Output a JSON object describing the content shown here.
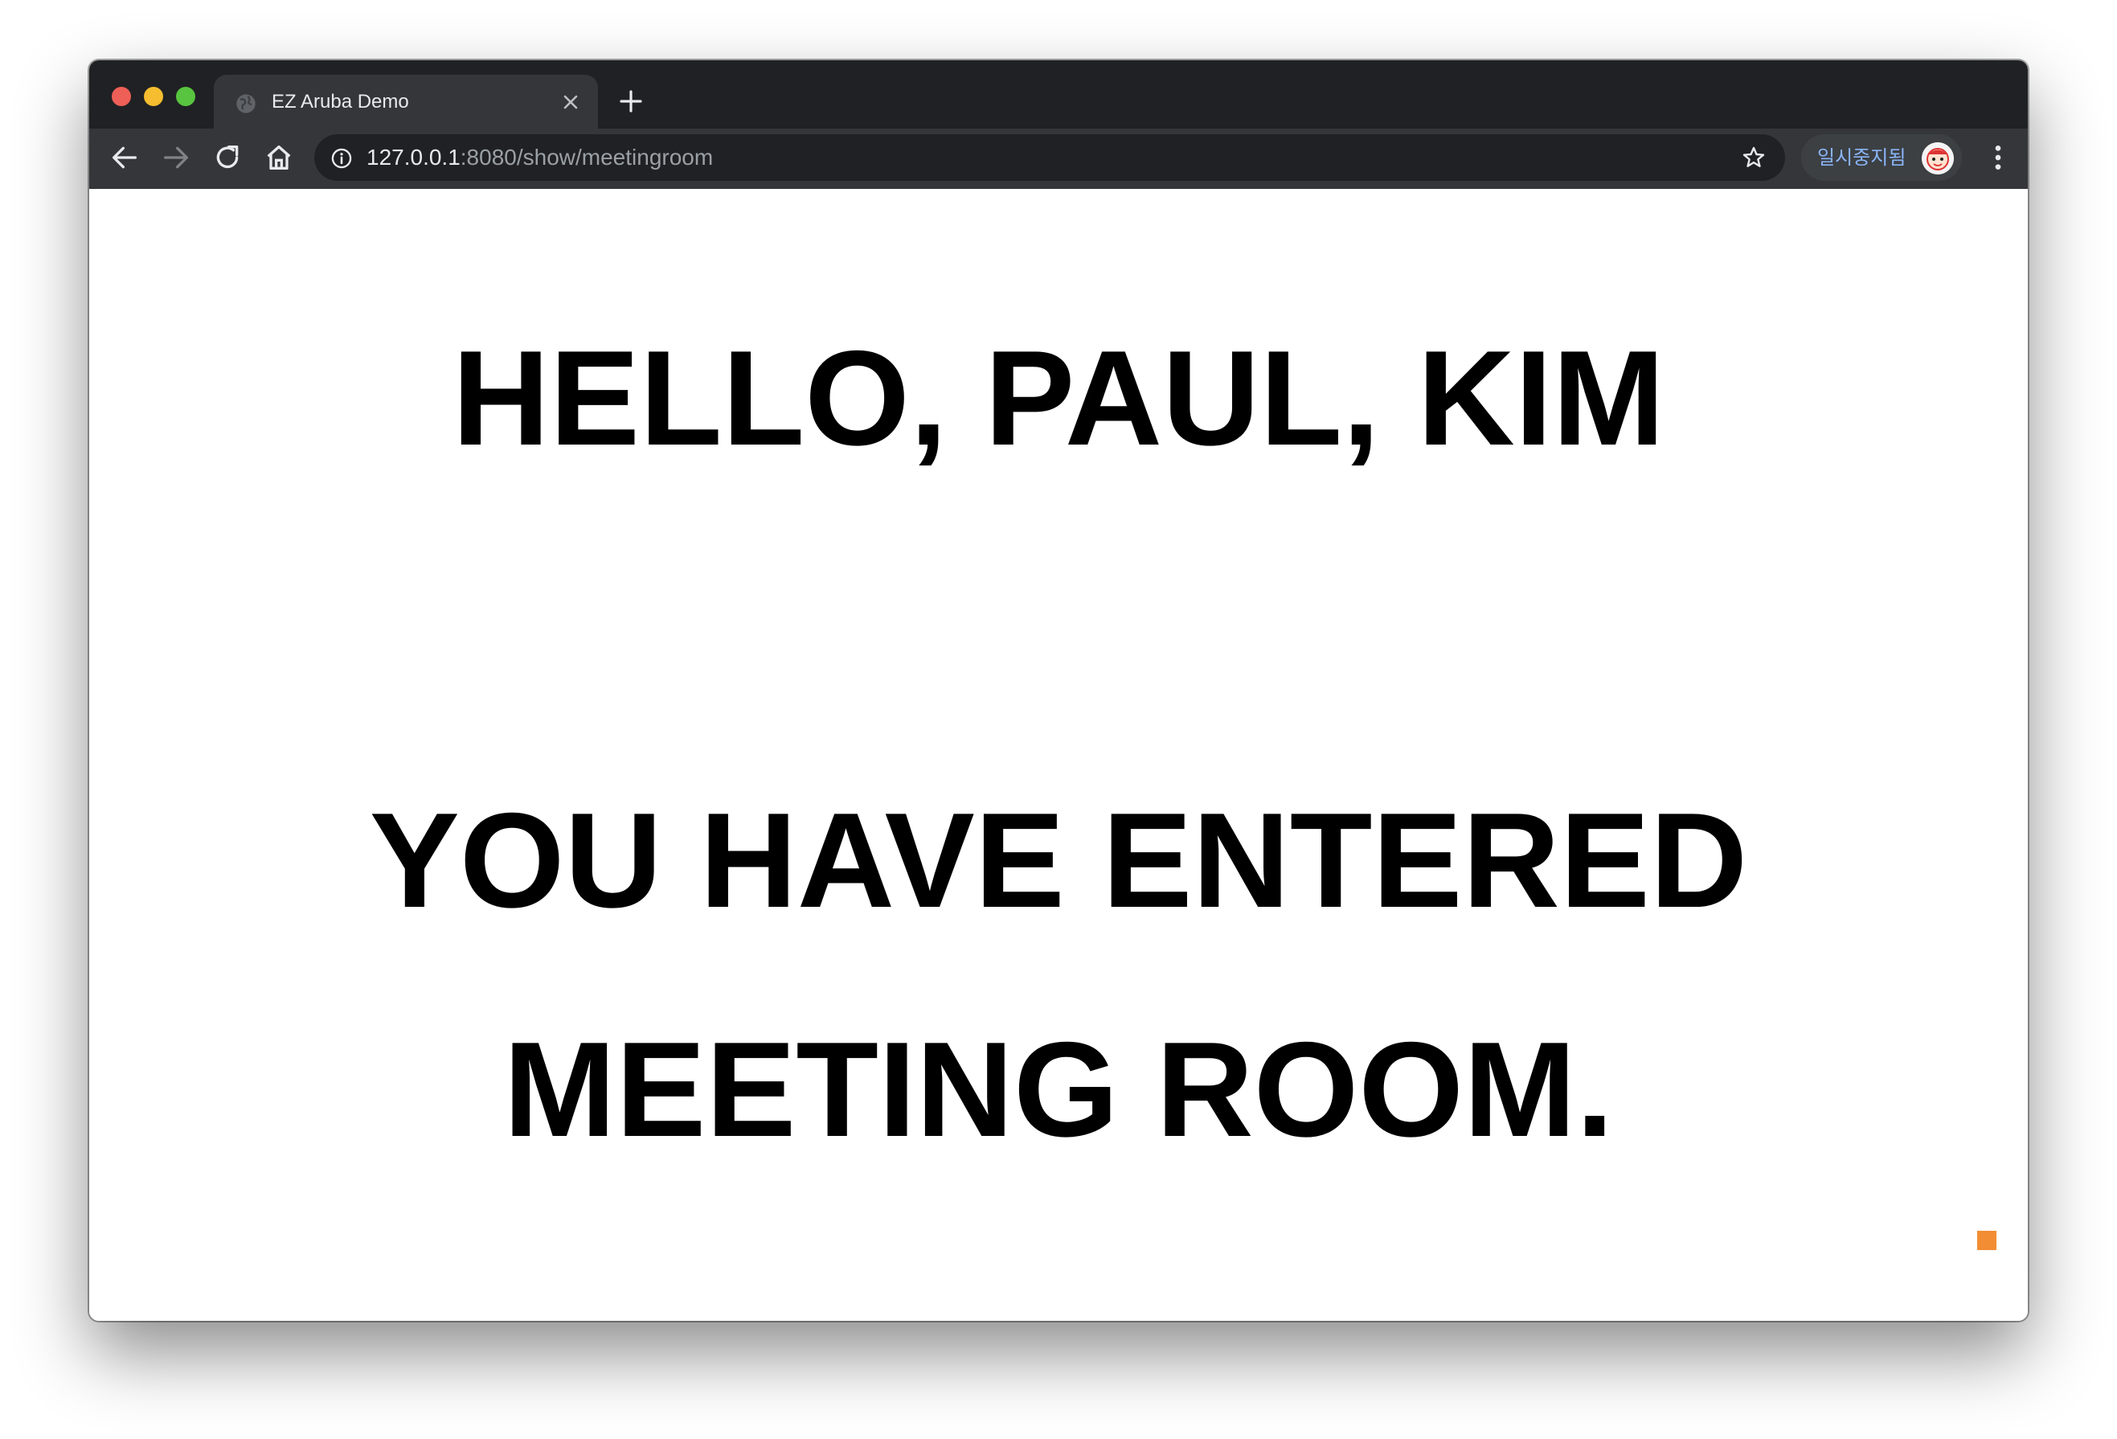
{
  "tab": {
    "title": "EZ Aruba Demo",
    "favicon": "globe-icon"
  },
  "toolbar": {
    "url_host": "127.0.0.1",
    "url_path": ":8080/show/meetingroom",
    "profile_label": "일시중지됨"
  },
  "page": {
    "line1": "HELLO, PAUL, KIM",
    "line2": "YOU HAVE ENTERED",
    "line3": "MEETING ROOM."
  },
  "colors": {
    "tab_strip": "#202124",
    "toolbar": "#35363a",
    "accent_square": "#f28d33",
    "profile_text": "#8ab4f8"
  }
}
